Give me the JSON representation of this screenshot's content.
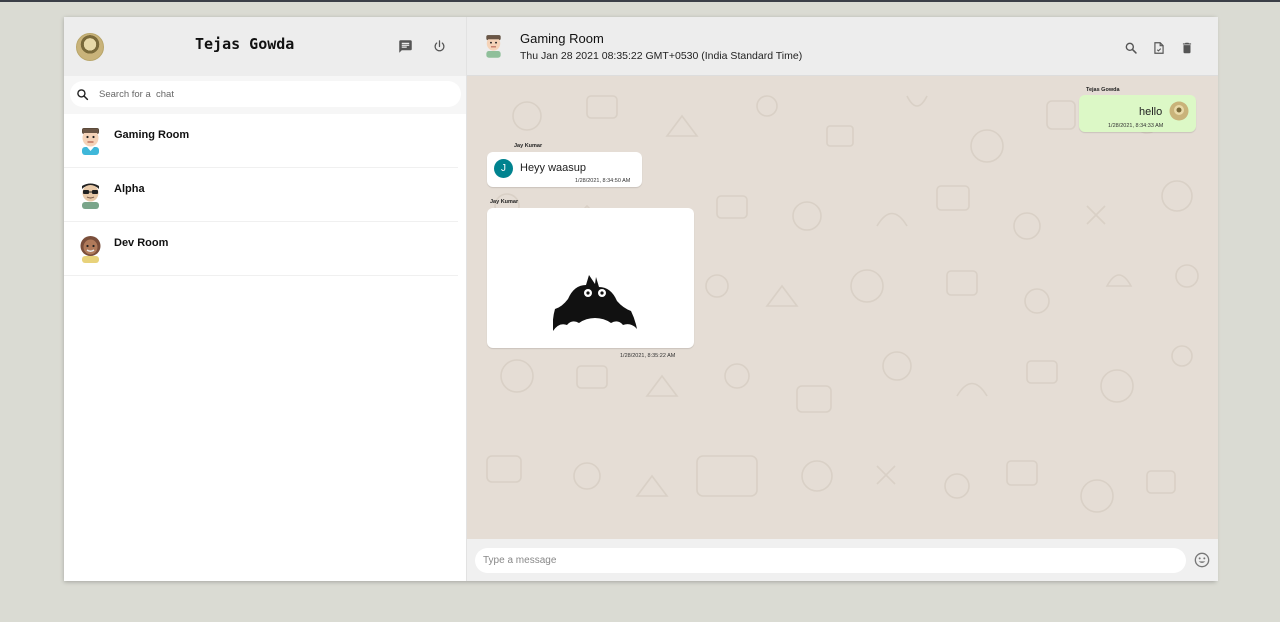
{
  "sidebar": {
    "user_name": "Tejas Gowda",
    "search": {
      "placeholder": "Search for a  chat"
    },
    "chats": [
      {
        "name": "Gaming Room",
        "avatar": "avatar-icon"
      },
      {
        "name": "Alpha",
        "avatar": "avatar-icon"
      },
      {
        "name": "Dev Room",
        "avatar": "avatar-icon"
      }
    ]
  },
  "chat": {
    "title": "Gaming Room",
    "subtitle": "Thu Jan 28 2021 08:35:22 GMT+0530 (India Standard Time)",
    "messages": [
      {
        "sender": "Tejas Gowda",
        "text": "hello",
        "time": "1/28/2021, 8:34:33 AM",
        "direction": "sent"
      },
      {
        "sender": "Jay Kumar",
        "avatar_letter": "J",
        "text": "Heyy waasup",
        "time": "1/28/2021, 8:34:50 AM",
        "direction": "received"
      },
      {
        "sender": "Jay Kumar",
        "image": "bat-image",
        "time": "1/28/2021, 8:35:22 AM",
        "direction": "received"
      }
    ],
    "input": {
      "placeholder": "Type a message"
    }
  },
  "colors": {
    "header_bg": "#ededed",
    "chat_bg": "#e5ddd5",
    "sent_bubble": "#dcf8c6",
    "letter_avatar": "#00838f"
  }
}
